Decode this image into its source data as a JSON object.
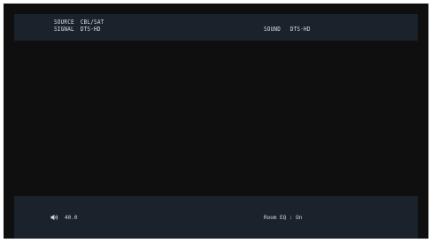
{
  "info_bar": {
    "source_label": "SOURCE",
    "source_value": "CBL/SAT",
    "signal_label": "SIGNAL",
    "signal_value": "DTS-HD",
    "sound_label": "SOUND",
    "sound_value": "DTS-HD"
  },
  "status_bar": {
    "speaker_icon": "speaker-volume-icon",
    "volume_value": "40.0",
    "room_eq_text": "Room EQ : On"
  },
  "colors": {
    "screen_background": "#0f0f10",
    "bar_background": "#1a232b",
    "text": "#d9dde2"
  }
}
